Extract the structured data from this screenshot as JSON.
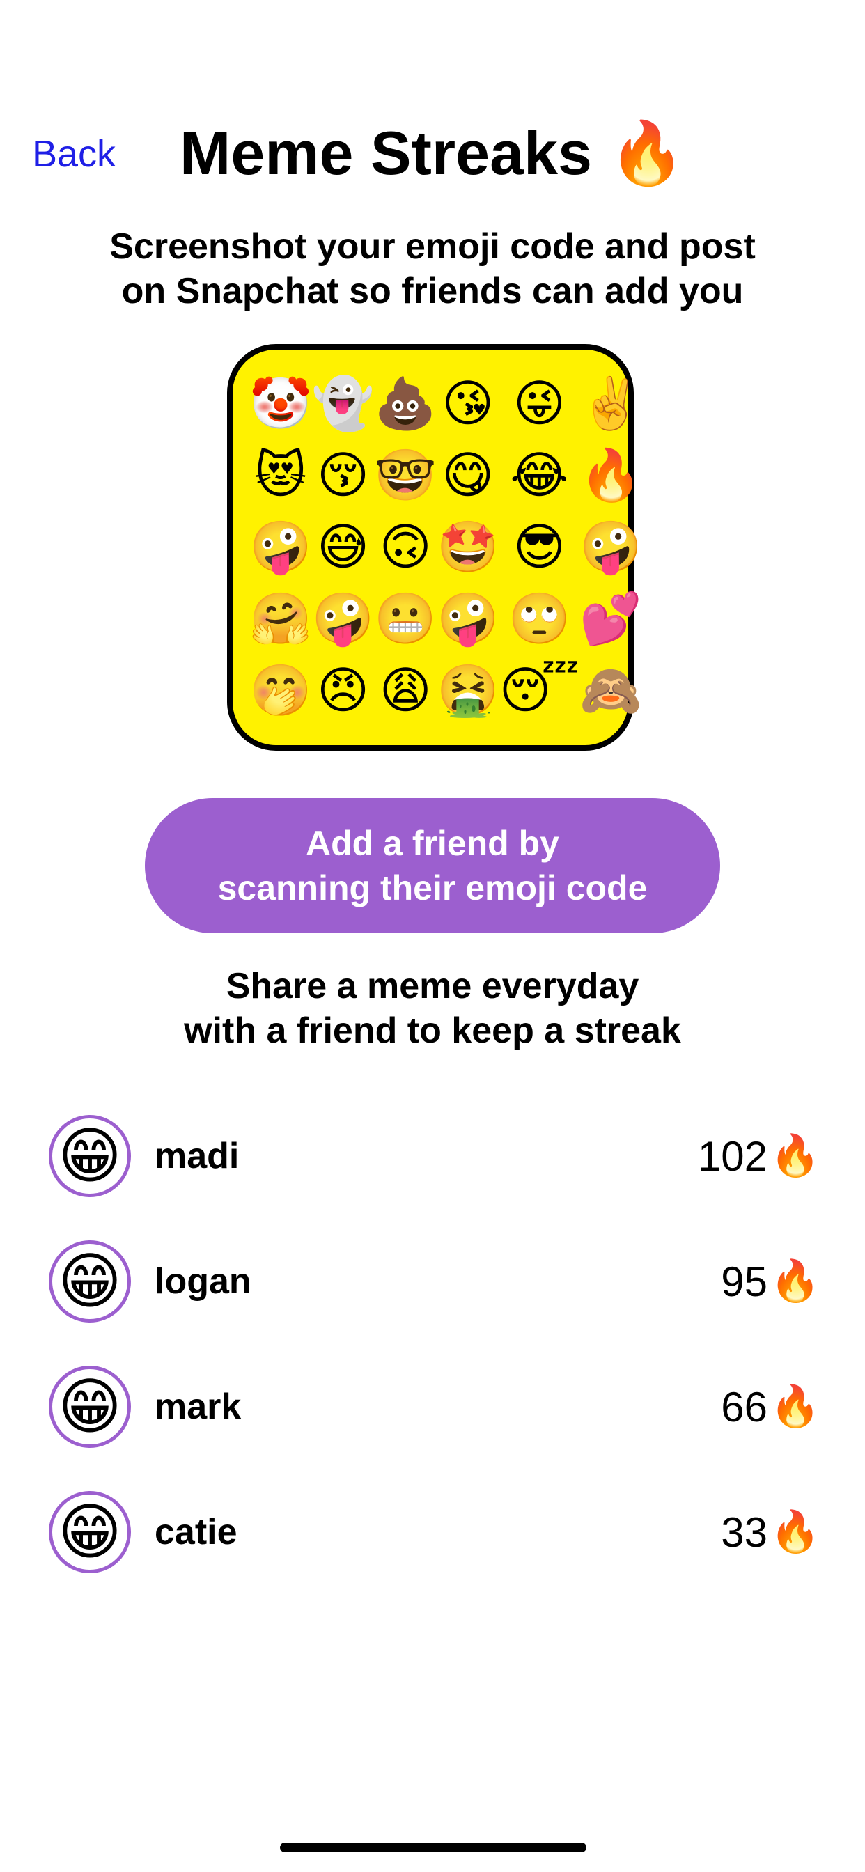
{
  "header": {
    "back_label": "Back",
    "title": "Meme Streaks 🔥"
  },
  "subtitle": "Screenshot your emoji code and post\non Snapchat so friends can add you",
  "emoji_code": {
    "background_color": "#fff200",
    "rows": [
      [
        "🤡",
        "👻",
        "💩",
        "😘",
        "😜",
        "✌️"
      ],
      [
        "😻",
        "😚",
        "🤓",
        "😋",
        "😂",
        "🔥"
      ],
      [
        "🤪",
        "😅",
        "🙃",
        "🤩",
        "😎",
        "🤪"
      ],
      [
        "🤗",
        "🤪",
        "😬",
        "🤪",
        "🙄",
        "💕"
      ],
      [
        "🤭",
        "😠",
        "😩",
        "🤮",
        "😴",
        "🙈"
      ]
    ]
  },
  "add_friend_button": {
    "label": "Add a friend by\nscanning their emoji code",
    "color": "#9c5fcf"
  },
  "share_caption": "Share a meme everyday\nwith a friend to keep a streak",
  "streaks": [
    {
      "avatar": "😁",
      "name": "madi",
      "count": "102",
      "fire": "🔥"
    },
    {
      "avatar": "😁",
      "name": "logan",
      "count": "95",
      "fire": "🔥"
    },
    {
      "avatar": "😁",
      "name": "mark",
      "count": "66",
      "fire": "🔥"
    },
    {
      "avatar": "😁",
      "name": "catie",
      "count": "33",
      "fire": "🔥"
    }
  ],
  "colors": {
    "link": "#1f1fe6",
    "accent": "#9c5fcf"
  }
}
